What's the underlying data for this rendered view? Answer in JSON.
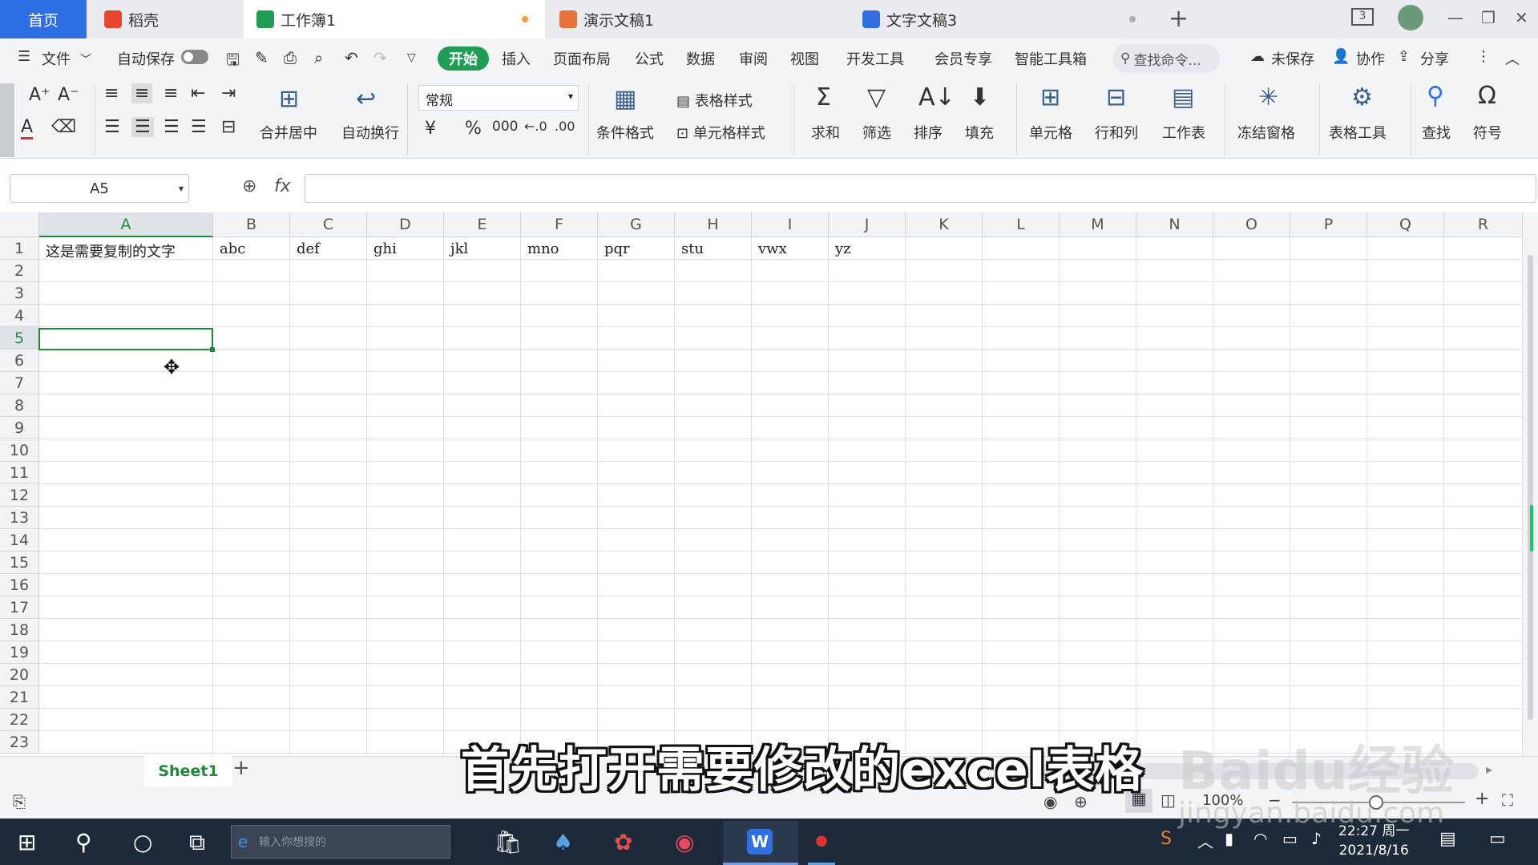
{
  "tabs": {
    "home": "首页",
    "items": [
      {
        "label": "稻壳",
        "color": "#e8462f"
      },
      {
        "label": "工作簿1",
        "color": "#1f9d55"
      },
      {
        "label": "演示文稿1",
        "color": "#e8733a"
      },
      {
        "label": "文字文稿3",
        "color": "#2f6fe4"
      }
    ],
    "new_tab_label": "+",
    "window_count": "3"
  },
  "menu": {
    "file": "文件",
    "autosave": "自动保存",
    "start": "开始",
    "items": [
      "插入",
      "页面布局",
      "公式",
      "数据",
      "审阅",
      "视图",
      "开发工具",
      "会员专享",
      "智能工具箱"
    ],
    "search_placeholder": "查找命令...",
    "unsaved": "未保存",
    "collab": "协作",
    "share": "分享"
  },
  "ribbon": {
    "merge_center": "合并居中",
    "wrap": "自动换行",
    "number_format": "常规",
    "currency": "¥",
    "percent": "%",
    "thousand": "000",
    "cond_format": "条件格式",
    "table_style": "表格样式",
    "cell_style": "单元格样式",
    "sum": "求和",
    "filter": "筛选",
    "sort": "排序",
    "fill": "填充",
    "cell": "单元格",
    "rowcol": "行和列",
    "worksheet": "工作表",
    "freeze": "冻结窗格",
    "table_tools": "表格工具",
    "find": "查找",
    "symbol": "符号"
  },
  "formula": {
    "name_box": "A5",
    "fx": "fx",
    "value": ""
  },
  "sheet": {
    "columns": [
      "A",
      "B",
      "C",
      "D",
      "E",
      "F",
      "G",
      "H",
      "I",
      "J",
      "K",
      "L",
      "M",
      "N",
      "O",
      "P",
      "Q",
      "R"
    ],
    "rows": [
      "1",
      "2",
      "3",
      "4",
      "5",
      "6",
      "7",
      "8",
      "9",
      "10",
      "11",
      "12",
      "13",
      "14",
      "15",
      "16",
      "17",
      "18",
      "19",
      "20",
      "21",
      "22",
      "23"
    ],
    "row1": [
      "这是需要复制的文字",
      "abc",
      "def",
      "ghi",
      "jkl",
      "mno",
      "pqr",
      "stu",
      "vwx",
      "yz"
    ],
    "selected_cell": "A5",
    "sheet_tab": "Sheet1",
    "add_sheet": "+"
  },
  "status": {
    "zoom": "100%"
  },
  "taskbar": {
    "search_placeholder": "输入你想搜的",
    "time": "22:27 周一",
    "date": "2021/8/16"
  },
  "overlay": {
    "caption": "首先打开需要修改的excel表格",
    "watermark": "Baidu经验",
    "watermark_url": "jingyan.baidu.com"
  }
}
